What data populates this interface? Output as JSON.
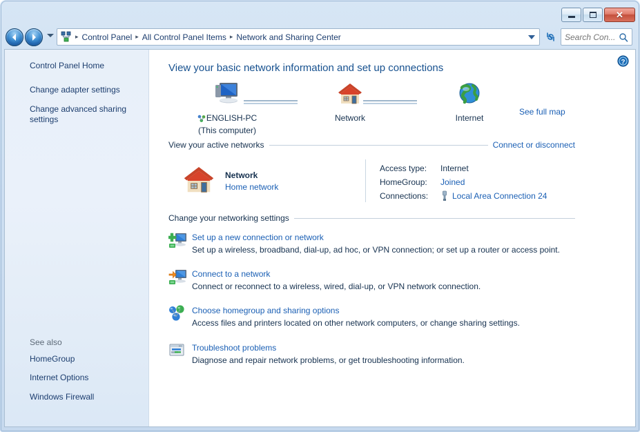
{
  "window": {
    "controls": {
      "minimize_label": "Minimize",
      "maximize_label": "Maximize",
      "close_label": "✕"
    }
  },
  "toolbar": {
    "back_label": "Back",
    "forward_label": "Forward",
    "recent_pages_label": "Recent pages",
    "breadcrumb": [
      "Control Panel",
      "All Control Panel Items",
      "Network and Sharing Center"
    ],
    "breadcrumb_separator": "▸",
    "refresh_label": "Refresh",
    "search": {
      "placeholder": "Search Con...",
      "value": ""
    }
  },
  "sidebar": {
    "links": [
      "Control Panel Home",
      "Change adapter settings",
      "Change advanced sharing settings"
    ],
    "see_also_label": "See also",
    "see_also_links": [
      "HomeGroup",
      "Internet Options",
      "Windows Firewall"
    ]
  },
  "main": {
    "help_label": "Help",
    "page_title": "View your basic network information and set up connections",
    "network_map": {
      "nodes": [
        {
          "label": "ENGLISH-PC",
          "sublabel": "(This computer)"
        },
        {
          "label": "Network",
          "sublabel": ""
        },
        {
          "label": "Internet",
          "sublabel": ""
        }
      ],
      "see_full_map": "See full map"
    },
    "active_networks": {
      "section_title": "View your active networks",
      "section_action": "Connect or disconnect",
      "network_name": "Network",
      "network_type": "Home network",
      "details": [
        {
          "label": "Access type:",
          "value": "Internet",
          "link": false,
          "icon": ""
        },
        {
          "label": "HomeGroup:",
          "value": "Joined",
          "link": true,
          "icon": ""
        },
        {
          "label": "Connections:",
          "value": "Local Area Connection 24",
          "link": true,
          "icon": "network-cable-icon"
        }
      ]
    },
    "settings": {
      "section_title": "Change your networking settings",
      "items": [
        {
          "icon": "add-connection-icon",
          "title": "Set up a new connection or network",
          "desc": "Set up a wireless, broadband, dial-up, ad hoc, or VPN connection; or set up a router or access point."
        },
        {
          "icon": "connect-network-icon",
          "title": "Connect to a network",
          "desc": "Connect or reconnect to a wireless, wired, dial-up, or VPN network connection."
        },
        {
          "icon": "homegroup-icon",
          "title": "Choose homegroup and sharing options",
          "desc": "Access files and printers located on other network computers, or change sharing settings."
        },
        {
          "icon": "troubleshoot-icon",
          "title": "Troubleshoot problems",
          "desc": "Diagnose and repair network problems, or get troubleshooting information."
        }
      ]
    }
  },
  "colors": {
    "link": "#1a5fb4",
    "title": "#17518f",
    "text": "#16314f",
    "frame": "#cfe0f2",
    "sidebar_bg": "#e8f0f9"
  }
}
